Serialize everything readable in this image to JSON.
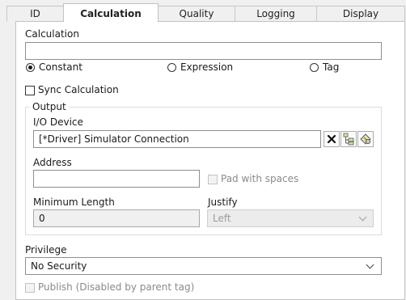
{
  "tabs": [
    {
      "label": "ID"
    },
    {
      "label": "Calculation"
    },
    {
      "label": "Quality"
    },
    {
      "label": "Logging"
    },
    {
      "label": "Display"
    }
  ],
  "active_tab": "Calculation",
  "calculation": {
    "label": "Calculation",
    "value": "",
    "modes": {
      "constant": "Constant",
      "expression": "Expression",
      "tag": "Tag"
    },
    "selected_mode": "Constant",
    "sync_label": "Sync Calculation",
    "sync_checked": false
  },
  "output": {
    "legend": "Output",
    "io_device_label": "I/O Device",
    "io_device_value": "[*Driver]    Simulator Connection",
    "address_label": "Address",
    "address_value": "",
    "pad_label": "Pad with spaces",
    "pad_checked": false,
    "min_length_label": "Minimum Length",
    "min_length_value": "0",
    "justify_label": "Justify",
    "justify_value": "Left",
    "icons": [
      "clear-icon",
      "browse-device-icon",
      "device-settings-icon"
    ]
  },
  "privilege": {
    "label": "Privilege",
    "value": "No Security"
  },
  "publish": {
    "label": "Publish (Disabled by parent tag)",
    "checked": false
  },
  "colors": {
    "panel": "#ffffff",
    "window": "#f0f0f0",
    "border": "#c2c2c2",
    "disabled_text": "#8a8a8a"
  }
}
